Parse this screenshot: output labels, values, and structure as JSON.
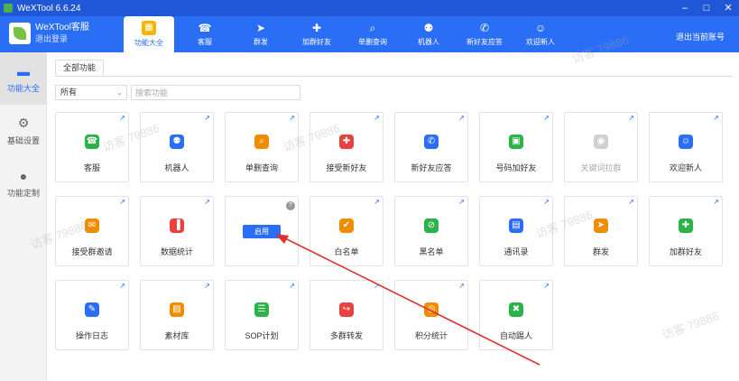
{
  "titlebar": {
    "title": "WeXTool 6.6.24"
  },
  "header": {
    "app_name": "WeXTool客服",
    "logout": "退出登录",
    "exit_account": "退出当前账号"
  },
  "nav": [
    {
      "label": "功能大全",
      "icon": "grid-icon"
    },
    {
      "label": "客服",
      "icon": "headset-icon"
    },
    {
      "label": "群发",
      "icon": "send-icon"
    },
    {
      "label": "加群好友",
      "icon": "add-user-icon"
    },
    {
      "label": "单删查询",
      "icon": "search-user-icon"
    },
    {
      "label": "机器人",
      "icon": "robot-icon"
    },
    {
      "label": "新好友应答",
      "icon": "phone-icon"
    },
    {
      "label": "欢迎新人",
      "icon": "welcome-icon"
    }
  ],
  "sidebar": [
    {
      "label": "功能大全",
      "icon": "monitor-icon"
    },
    {
      "label": "基础设置",
      "icon": "gear-icon"
    },
    {
      "label": "功能定制",
      "icon": "user-icon"
    }
  ],
  "tab": {
    "label": "全部功能"
  },
  "filter": {
    "selected": "所有",
    "search_placeholder": "搜索功能"
  },
  "popup": {
    "enable_label": "启用",
    "help": "?"
  },
  "watermark": "访客 79886",
  "cards": [
    {
      "label": "客服",
      "icon": "headset-icon",
      "color": "#2bb34a"
    },
    {
      "label": "机器人",
      "icon": "robot-icon",
      "color": "#2a6ef6"
    },
    {
      "label": "单删查询",
      "icon": "search-user-icon",
      "color": "#f08c00"
    },
    {
      "label": "接受新好友",
      "icon": "add-user-icon",
      "color": "#e8423f"
    },
    {
      "label": "新好友应答",
      "icon": "phone-icon",
      "color": "#2a6ef6"
    },
    {
      "label": "号码加好友",
      "icon": "contact-card-icon",
      "color": "#2bb34a"
    },
    {
      "label": "关键词拉群",
      "icon": "keyword-group-icon",
      "color": "#d0d0d0"
    },
    {
      "label": "欢迎新人",
      "icon": "welcome-icon",
      "color": "#2a6ef6"
    },
    {
      "label": "接受群邀请",
      "icon": "mail-icon",
      "color": "#f08c00"
    },
    {
      "label": "数据统计",
      "icon": "bar-chart-icon",
      "color": "#e8423f"
    },
    {
      "label": "",
      "icon": "",
      "color": "#ffffff"
    },
    {
      "label": "白名单",
      "icon": "user-check-icon",
      "color": "#f08c00"
    },
    {
      "label": "黑名单",
      "icon": "user-block-icon",
      "color": "#2bb34a"
    },
    {
      "label": "通讯录",
      "icon": "address-book-icon",
      "color": "#2a6ef6"
    },
    {
      "label": "群发",
      "icon": "send-icon",
      "color": "#f08c00"
    },
    {
      "label": "加群好友",
      "icon": "add-user-icon",
      "color": "#2bb34a"
    },
    {
      "label": "操作日志",
      "icon": "edit-icon",
      "color": "#2a6ef6"
    },
    {
      "label": "素材库",
      "icon": "image-icon",
      "color": "#f08c00"
    },
    {
      "label": "SOP计划",
      "icon": "plan-icon",
      "color": "#2bb34a"
    },
    {
      "label": "多群转发",
      "icon": "forward-icon",
      "color": "#e8423f"
    },
    {
      "label": "积分统计",
      "icon": "coins-icon",
      "color": "#f08c00"
    },
    {
      "label": "自动踢人",
      "icon": "kick-user-icon",
      "color": "#2bb34a"
    }
  ]
}
